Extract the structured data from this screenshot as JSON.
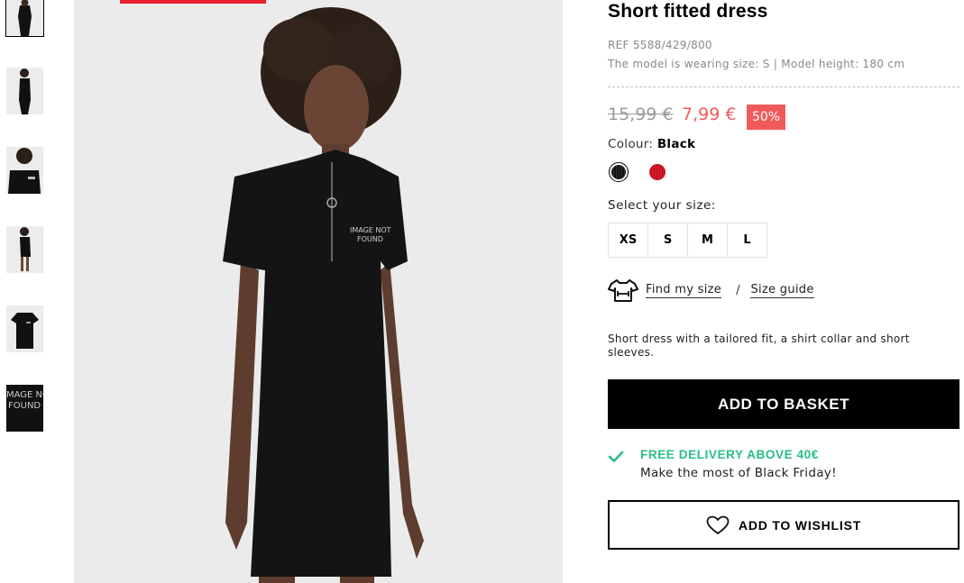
{
  "product": {
    "title": "Short fitted dress",
    "ref": "REF 5588/429/800",
    "model_info": "The model is wearing size: S | Model height: 180 cm",
    "old_price": "15,99 €",
    "new_price": "7,99 €",
    "discount": "50%",
    "colour_label": "Colour:",
    "colour_value": "Black",
    "colours": [
      {
        "name": "black",
        "hex": "#111111",
        "selected": true
      },
      {
        "name": "red",
        "hex": "#d81a2a",
        "selected": false
      }
    ],
    "size_label": "Select your size:",
    "sizes": [
      "XS",
      "S",
      "M",
      "L"
    ],
    "find_size": "Find my size",
    "separator": "/",
    "size_guide": "Size guide",
    "description": "Short dress with a tailored fit, a shirt collar and short sleeves.",
    "add_to_basket": "ADD TO BASKET",
    "delivery_title": "FREE DELIVERY ABOVE 40€",
    "delivery_sub": "Make the most of Black Friday!",
    "add_to_wishlist": "ADD TO WISHLIST"
  },
  "gallery": {
    "thumbnails": [
      "full-look-front",
      "full-look-side",
      "upper-body-closeup",
      "full-look-back",
      "flat-lay-dress",
      "fabric-detail"
    ],
    "active_index": 0,
    "print_text": "IMAGE NOT FOUND"
  },
  "colors": {
    "sale_red": "#f05a5a",
    "delivery_green": "#28bf84",
    "accent_red": "#e8202f"
  },
  "icons": {
    "tee": "t-shirt-measure-icon",
    "check": "check-icon",
    "heart": "heart-icon"
  }
}
